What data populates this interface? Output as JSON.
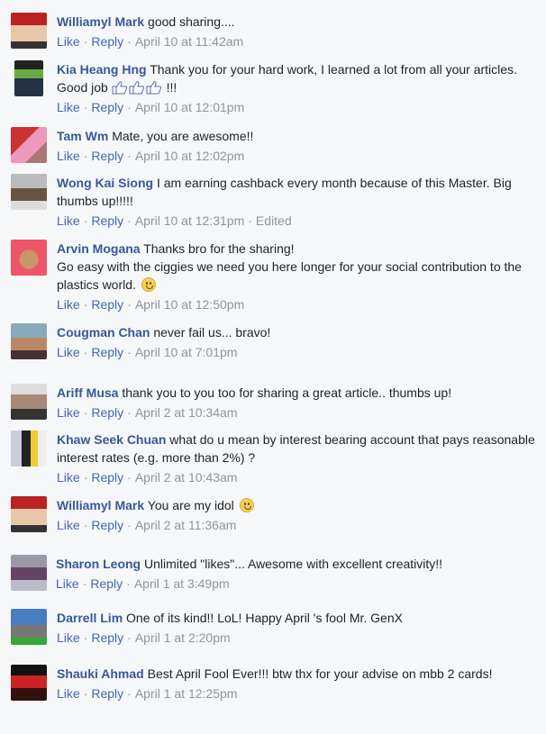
{
  "actions": {
    "like": "Like",
    "reply": "Reply",
    "sep": "·"
  },
  "comments": [
    {
      "author": "Williamyl Mark",
      "text": "good sharing....",
      "time": "April 10 at 11:42am"
    },
    {
      "author": "Kia Heang Hng",
      "text": "Thank you for your hard work, I learned a lot from all your articles. Good job",
      "text_after": "!!!",
      "time": "April 10 at 12:01pm"
    },
    {
      "author": "Tam Wm",
      "text": "Mate, you are awesome!!",
      "time": "April 10 at 12:02pm"
    },
    {
      "author": "Wong Kai Siong",
      "text": "I am earning cashback every month because of this Master. Big thumbs up!!!!!",
      "time": "April 10 at 12:31pm",
      "edited": "Edited"
    },
    {
      "author": "Arvin Mogana",
      "text": "Thanks bro for the sharing!",
      "text2": "Go easy with the ciggies we need you here longer for your social contribution to the plastics world.",
      "time": "April 10 at 12:50pm"
    },
    {
      "author": "Cougman Chan",
      "text": "never fail us... bravo!",
      "time": "April 10 at 7:01pm"
    },
    {
      "author": "Ariff Musa",
      "text": "thank you to you too for sharing a great article.. thumbs up!",
      "time": "April 2 at 10:34am"
    },
    {
      "author": "Khaw Seek Chuan",
      "text": "what do u mean by interest bearing account that pays reasonable interest rates (e.g. more than 2%) ?",
      "time": "April 2 at 10:43am"
    },
    {
      "author": "Williamyl Mark",
      "text": "You are my idol",
      "time": "April 2 at 11:36am"
    },
    {
      "author": "Sharon Leong",
      "text": "Unlimited \"likes\"... Awesome with excellent creativity!!",
      "time": "April 1 at 3:49pm"
    },
    {
      "author": "Darrell Lim",
      "text": "One of its kind!! LoL! Happy April 's fool Mr. GenX",
      "time": "April 1 at 2:20pm"
    },
    {
      "author": "Shauki Ahmad",
      "text": "Best April Fool Ever!!! btw thx for your advise on mbb 2 cards!",
      "time": "April 1 at 12:25pm"
    }
  ]
}
